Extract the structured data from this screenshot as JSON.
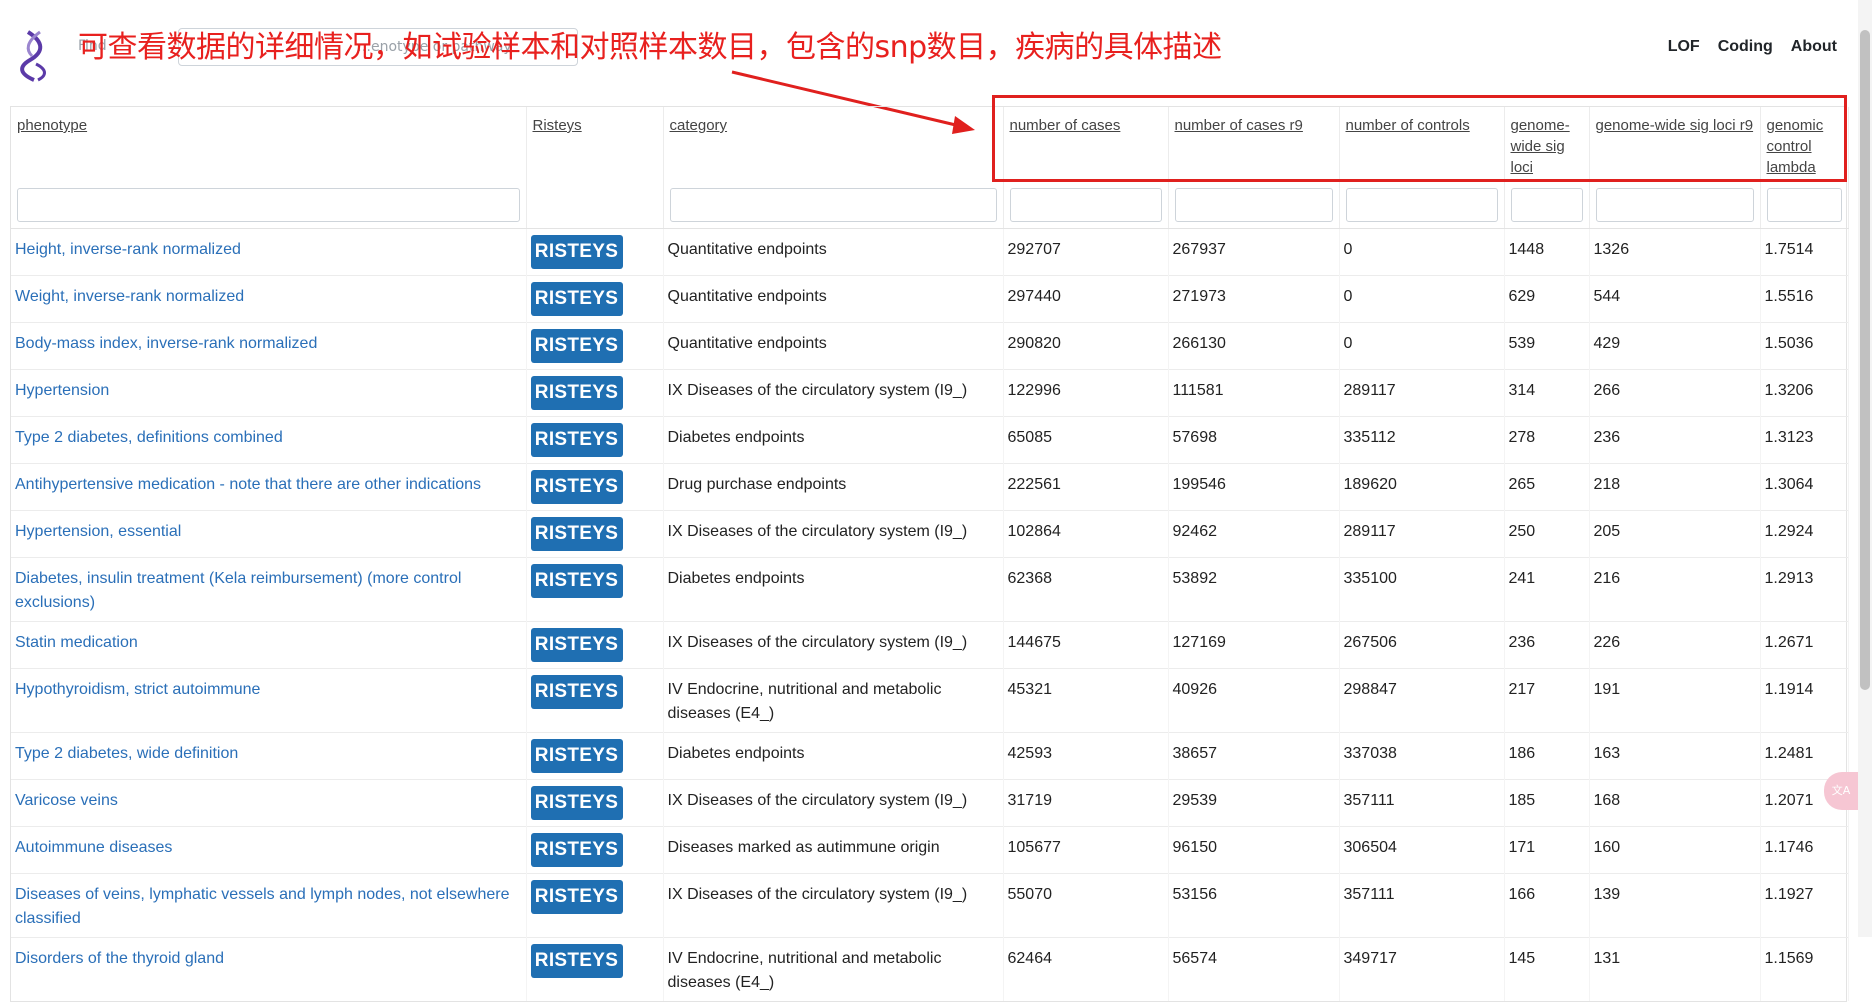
{
  "annotation": "可查看数据的详细情况，如试验样本和对照样本数目，包含的snp数目，疾病的具体描述",
  "search": {
    "prefix": "Find ",
    "placeholder": "…enotype or pathway"
  },
  "nav": {
    "lof": "LOF",
    "coding": "Coding",
    "about": "About"
  },
  "columns": {
    "phenotype": "phenotype",
    "risteys": "Risteys",
    "category": "category",
    "cases": "number of cases",
    "cases_r9": "number of cases r9",
    "controls": "number of controls",
    "gw_sig_loci": "genome-wide sig loci",
    "gw_sig_loci_r9": "genome-wide sig loci r9",
    "lambda": "genomic control lambda"
  },
  "button_label": "RISTEYS",
  "rows": [
    {
      "phenotype": "Height, inverse-rank normalized",
      "category": "Quantitative endpoints",
      "cases": "292707",
      "cases_r9": "267937",
      "controls": "0",
      "loci": "1448",
      "loci_r9": "1326",
      "lambda": "1.7514"
    },
    {
      "phenotype": "Weight, inverse-rank normalized",
      "category": "Quantitative endpoints",
      "cases": "297440",
      "cases_r9": "271973",
      "controls": "0",
      "loci": "629",
      "loci_r9": "544",
      "lambda": "1.5516"
    },
    {
      "phenotype": "Body-mass index, inverse-rank normalized",
      "category": "Quantitative endpoints",
      "cases": "290820",
      "cases_r9": "266130",
      "controls": "0",
      "loci": "539",
      "loci_r9": "429",
      "lambda": "1.5036"
    },
    {
      "phenotype": "Hypertension",
      "category": "IX Diseases of the circulatory system (I9_)",
      "cases": "122996",
      "cases_r9": "111581",
      "controls": "289117",
      "loci": "314",
      "loci_r9": "266",
      "lambda": "1.3206"
    },
    {
      "phenotype": "Type 2 diabetes, definitions combined",
      "category": "Diabetes endpoints",
      "cases": "65085",
      "cases_r9": "57698",
      "controls": "335112",
      "loci": "278",
      "loci_r9": "236",
      "lambda": "1.3123"
    },
    {
      "phenotype": "Antihypertensive medication - note that there are other indications",
      "category": "Drug purchase endpoints",
      "cases": "222561",
      "cases_r9": "199546",
      "controls": "189620",
      "loci": "265",
      "loci_r9": "218",
      "lambda": "1.3064"
    },
    {
      "phenotype": "Hypertension, essential",
      "category": "IX Diseases of the circulatory system (I9_)",
      "cases": "102864",
      "cases_r9": "92462",
      "controls": "289117",
      "loci": "250",
      "loci_r9": "205",
      "lambda": "1.2924"
    },
    {
      "phenotype": "Diabetes, insulin treatment (Kela reimbursement) (more control exclusions)",
      "category": "Diabetes endpoints",
      "cases": "62368",
      "cases_r9": "53892",
      "controls": "335100",
      "loci": "241",
      "loci_r9": "216",
      "lambda": "1.2913"
    },
    {
      "phenotype": "Statin medication",
      "category": "IX Diseases of the circulatory system (I9_)",
      "cases": "144675",
      "cases_r9": "127169",
      "controls": "267506",
      "loci": "236",
      "loci_r9": "226",
      "lambda": "1.2671"
    },
    {
      "phenotype": "Hypothyroidism, strict autoimmune",
      "category": "IV Endocrine, nutritional and metabolic diseases (E4_)",
      "cases": "45321",
      "cases_r9": "40926",
      "controls": "298847",
      "loci": "217",
      "loci_r9": "191",
      "lambda": "1.1914"
    },
    {
      "phenotype": "Type 2 diabetes, wide definition",
      "category": "Diabetes endpoints",
      "cases": "42593",
      "cases_r9": "38657",
      "controls": "337038",
      "loci": "186",
      "loci_r9": "163",
      "lambda": "1.2481"
    },
    {
      "phenotype": "Varicose veins",
      "category": "IX Diseases of the circulatory system (I9_)",
      "cases": "31719",
      "cases_r9": "29539",
      "controls": "357111",
      "loci": "185",
      "loci_r9": "168",
      "lambda": "1.2071"
    },
    {
      "phenotype": "Autoimmune diseases",
      "category": "Diseases marked as autimmune origin",
      "cases": "105677",
      "cases_r9": "96150",
      "controls": "306504",
      "loci": "171",
      "loci_r9": "160",
      "lambda": "1.1746"
    },
    {
      "phenotype": "Diseases of veins, lymphatic vessels and lymph nodes, not elsewhere classified",
      "category": "IX Diseases of the circulatory system (I9_)",
      "cases": "55070",
      "cases_r9": "53156",
      "controls": "357111",
      "loci": "166",
      "loci_r9": "139",
      "lambda": "1.1927"
    },
    {
      "phenotype": "Disorders of the thyroid gland",
      "category": "IV Endocrine, nutritional and metabolic diseases (E4_)",
      "cases": "62464",
      "cases_r9": "56574",
      "controls": "349717",
      "loci": "145",
      "loci_r9": "131",
      "lambda": "1.1569"
    }
  ],
  "colors": {
    "link": "#2a6fb8",
    "button": "#1f6fb2",
    "annotation": "#e0201e"
  },
  "icons": {
    "logo": "dna-helix-icon"
  }
}
